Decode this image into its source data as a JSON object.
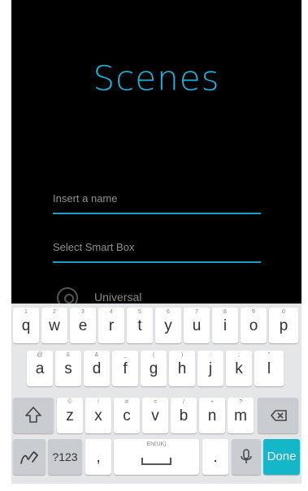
{
  "screen": {
    "title": "Scenes"
  },
  "form": {
    "name_placeholder": "Insert a name",
    "smartbox_placeholder": "Select Smart Box",
    "universal_label": "Universal"
  },
  "keyboard": {
    "row1": [
      {
        "k": "q",
        "h": "1"
      },
      {
        "k": "w",
        "h": "2"
      },
      {
        "k": "e",
        "h": "3"
      },
      {
        "k": "r",
        "h": "4"
      },
      {
        "k": "t",
        "h": "5"
      },
      {
        "k": "y",
        "h": "6"
      },
      {
        "k": "u",
        "h": "7"
      },
      {
        "k": "i",
        "h": "8"
      },
      {
        "k": "o",
        "h": "9"
      },
      {
        "k": "p",
        "h": "0"
      }
    ],
    "row2": [
      {
        "k": "a",
        "h": "@"
      },
      {
        "k": "s",
        "h": "£"
      },
      {
        "k": "d",
        "h": "&"
      },
      {
        "k": "f",
        "h": "_"
      },
      {
        "k": "g",
        "h": "("
      },
      {
        "k": "h",
        "h": ")"
      },
      {
        "k": "j",
        "h": ":"
      },
      {
        "k": "k",
        "h": ";"
      },
      {
        "k": "l",
        "h": "\""
      }
    ],
    "row3": [
      {
        "k": "z",
        "h": "©"
      },
      {
        "k": "x",
        "h": "!"
      },
      {
        "k": "c",
        "h": "#"
      },
      {
        "k": "v",
        "h": "="
      },
      {
        "k": "b",
        "h": "/"
      },
      {
        "k": "n",
        "h": "+"
      },
      {
        "k": "m",
        "h": "?"
      }
    ],
    "symbols_label": "?123",
    "comma_label": ",",
    "period_label": ".",
    "space_label": "EN(UK)",
    "done_label": "Done",
    "icons": {
      "shift": "shift-icon",
      "backspace": "backspace-icon",
      "handwriting": "handwriting-icon",
      "mic": "mic-icon"
    }
  },
  "colors": {
    "accent": "#1ab4dd",
    "done_key": "#13b7c9",
    "background": "#000000",
    "keyboard_bg": "#e4e6e8"
  }
}
